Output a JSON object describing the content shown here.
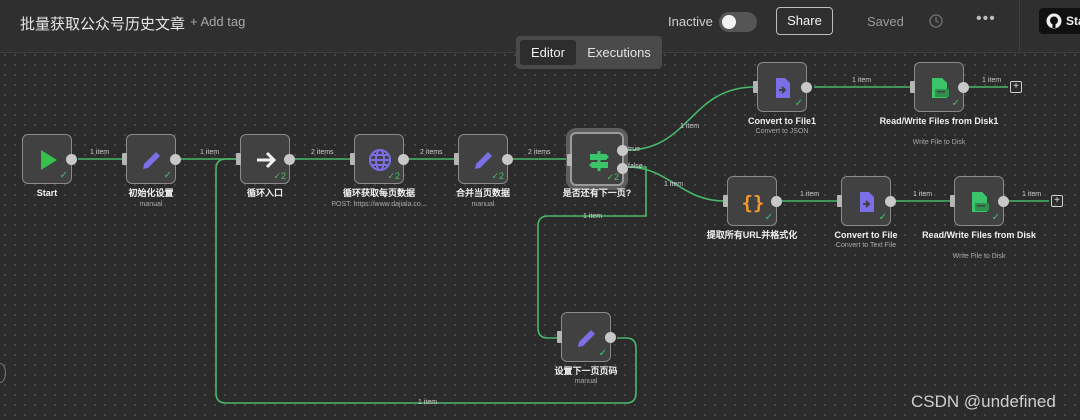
{
  "header": {
    "title": "批量获取公众号历史文章",
    "add_tag": "+ Add tag",
    "status": "Inactive",
    "share": "Share",
    "saved": "Saved",
    "more": "•••",
    "github": "Sta"
  },
  "tabs": {
    "editor": "Editor",
    "executions": "Executions"
  },
  "nodes": {
    "start": {
      "label": "Start"
    },
    "init": {
      "label": "初始化设置",
      "sub": "manual"
    },
    "loop": {
      "label": "循环入口",
      "count": "2"
    },
    "fetch": {
      "label": "循环获取每页数据",
      "sub": "POST: https://www.dajiala.co...",
      "count": "2"
    },
    "merge": {
      "label": "合并当页数据",
      "sub": "manual",
      "count": "2"
    },
    "ifnext": {
      "label": "是否还有下一页?",
      "count": "2",
      "true_label": "true",
      "false_label": "false"
    },
    "conv1": {
      "label": "Convert to File1",
      "sub": "Convert to JSON"
    },
    "rw1": {
      "label": "Read/Write Files from Disk1",
      "sub": "Write File to Disk"
    },
    "extract": {
      "label": "提取所有URL并格式化"
    },
    "conv2": {
      "label": "Convert to File",
      "sub": "Convert to Text File"
    },
    "rw2": {
      "label": "Read/Write Files from Disk",
      "sub": "Write File to Disk"
    },
    "setpage": {
      "label": "设置下一页页码",
      "sub": "manual"
    }
  },
  "edges": {
    "e_start_init": "1 item",
    "e_init_loop": "1 item",
    "e_loop_fetch": "2 items",
    "e_fetch_merge": "2 items",
    "e_merge_if": "2 items",
    "e_true_conv1": "1 item",
    "e_conv1_rw1": "1 item",
    "e_rw1_out": "1 item",
    "e_false_extract": "1 item",
    "e_extract_conv2": "1 item",
    "e_conv2_rw2": "1 item",
    "e_rw2_out": "1 item",
    "e_false_setpage": "1 item",
    "e_setpage_loop": "1 item"
  },
  "watermark": "CSDN @undefined",
  "colors": {
    "start": "#35c04a",
    "edit": "#7b6fe8",
    "arrow": "#f0f0f0",
    "globe": "#7b6fe8",
    "signpost": "#3cc46a",
    "file_convert": "#7b6fe8",
    "disk": "#3cc46a",
    "code": "#f39a2e",
    "check": "#46c06b"
  }
}
